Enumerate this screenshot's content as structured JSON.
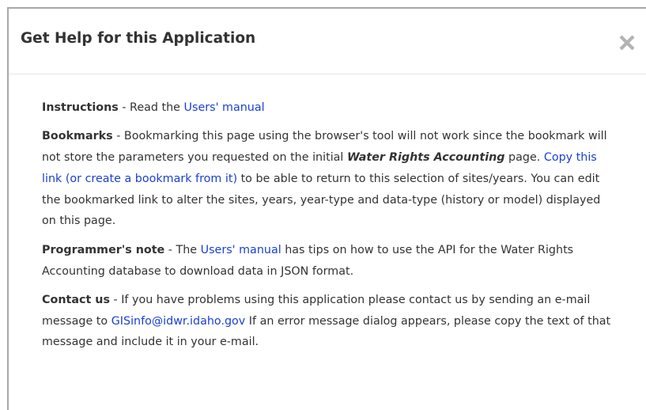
{
  "dialog": {
    "title": "Get Help for this Application",
    "close_icon": "close-x-icon"
  },
  "instructions": {
    "label": "Instructions",
    "sep": " - ",
    "text": "Read the ",
    "link": "Users' manual"
  },
  "bookmarks": {
    "label": "Bookmarks",
    "sep": " - ",
    "text1": "Bookmarking this page using the browser's tool will not work since the bookmark will not store the parameters you requested on the initial ",
    "emphasis": "Water Rights Accounting",
    "text2": " page. ",
    "link": "Copy this link (or create a bookmark from it)",
    "text3": " to be able to return to this selection of sites/years. You can edit the bookmarked link to alter the sites, years, year-type and data-type (history or model) displayed on this page."
  },
  "programmer": {
    "label": "Programmer's note",
    "sep": " - ",
    "text1": "The ",
    "link": "Users' manual",
    "text2": " has tips on how to use the API for the Water Rights Accounting database to download data in JSON format."
  },
  "contact": {
    "label": "Contact us",
    "sep": " - ",
    "text1": "If you have problems using this application please contact us by sending an e-mail message to ",
    "link": "GISinfo@idwr.idaho.gov",
    "text2": " If an error message dialog appears, please copy the text of that message and include it in your e-mail."
  },
  "colors": {
    "link": "#1a3fd6",
    "text": "#333333",
    "close_icon": "#b3b3b3",
    "frame": "#a8a8a8"
  }
}
